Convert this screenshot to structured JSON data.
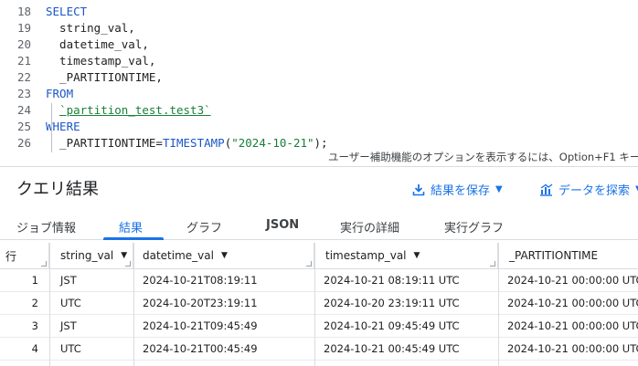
{
  "editor": {
    "lines": [
      {
        "n": "18",
        "parts": [
          {
            "t": "SELECT",
            "c": "kw"
          }
        ]
      },
      {
        "n": "19",
        "parts": [
          {
            "t": "  string_val,",
            "c": ""
          }
        ]
      },
      {
        "n": "20",
        "parts": [
          {
            "t": "  datetime_val,",
            "c": ""
          }
        ]
      },
      {
        "n": "21",
        "parts": [
          {
            "t": "  timestamp_val,",
            "c": ""
          }
        ]
      },
      {
        "n": "22",
        "parts": [
          {
            "t": "  _PARTITIONTIME,",
            "c": ""
          }
        ]
      },
      {
        "n": "23",
        "parts": [
          {
            "t": "FROM",
            "c": "kw"
          }
        ]
      },
      {
        "n": "24",
        "parts": [
          {
            "t": "  ",
            "c": ""
          },
          {
            "t": "`partition_test.test3`",
            "c": "tbl"
          }
        ]
      },
      {
        "n": "25",
        "parts": [
          {
            "t": "WHERE",
            "c": "kw"
          }
        ]
      },
      {
        "n": "26",
        "parts": [
          {
            "t": "  _PARTITIONTIME",
            "c": ""
          },
          {
            "t": "=",
            "c": ""
          },
          {
            "t": "TIMESTAMP",
            "c": "kw"
          },
          {
            "t": "(",
            "c": ""
          },
          {
            "t": "\"2024-10-21\"",
            "c": "str"
          },
          {
            "t": ");",
            "c": ""
          }
        ]
      }
    ],
    "a11y_hint": "ユーザー補助機能のオプションを表示するには、Option+F1 キー"
  },
  "results": {
    "title": "クエリ結果",
    "save_label": "結果を保存",
    "explore_label": "データを探索"
  },
  "tabs": [
    "ジョブ情報",
    "結果",
    "グラフ",
    "JSON",
    "実行の詳細",
    "実行グラフ"
  ],
  "table": {
    "row_header": "行",
    "columns": [
      "string_val",
      "datetime_val",
      "timestamp_val",
      "_PARTITIONTIME"
    ],
    "rows": [
      [
        "1",
        "JST",
        "2024-10-21T08:19:11",
        "2024-10-21 08:19:11 UTC",
        "2024-10-21 00:00:00 UTC"
      ],
      [
        "2",
        "UTC",
        "2024-10-20T23:19:11",
        "2024-10-20 23:19:11 UTC",
        "2024-10-21 00:00:00 UTC"
      ],
      [
        "3",
        "JST",
        "2024-10-21T09:45:49",
        "2024-10-21 09:45:49 UTC",
        "2024-10-21 00:00:00 UTC"
      ],
      [
        "4",
        "UTC",
        "2024-10-21T00:45:49",
        "2024-10-21 00:45:49 UTC",
        "2024-10-21 00:00:00 UTC"
      ]
    ]
  },
  "colors": {
    "accent": "#1a73e8",
    "keyword": "#1a57c8",
    "string": "#188038"
  }
}
